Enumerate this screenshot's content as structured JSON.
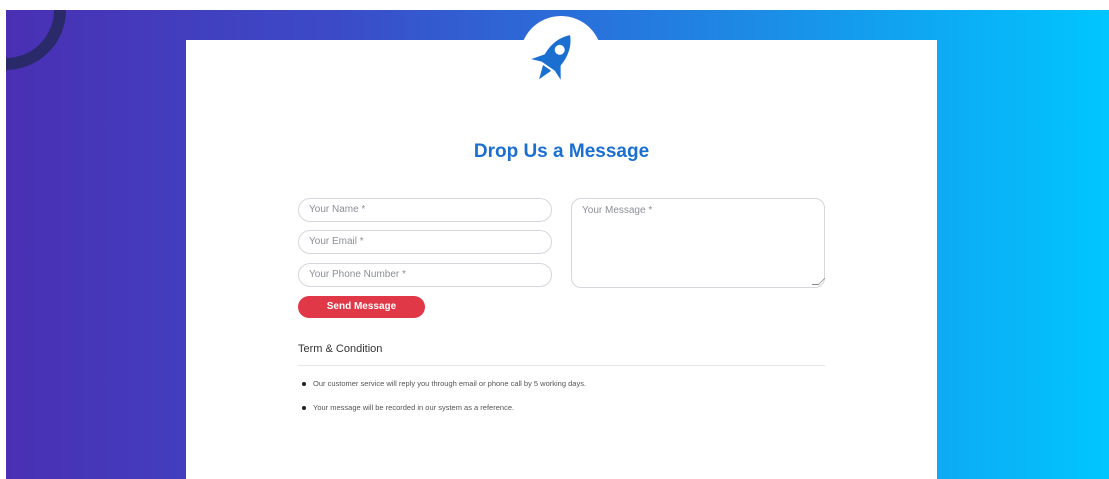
{
  "header": {
    "title": "Drop Us a Message"
  },
  "form": {
    "name_placeholder": "Your Name *",
    "email_placeholder": "Your Email *",
    "phone_placeholder": "Your Phone Number *",
    "message_placeholder": "Your Message *",
    "send_label": "Send Message"
  },
  "terms": {
    "title": "Term & Condition",
    "items": [
      "Our customer service will reply you through email or phone call by 5 working days.",
      "Your message will be recorded in our system as a reference."
    ]
  },
  "icons": {
    "logo": "rocket-icon"
  },
  "colors": {
    "gradient_start": "#4a2fb3",
    "gradient_end": "#00c6ff",
    "accent": "#1a6fd1",
    "button": "#e03847"
  }
}
